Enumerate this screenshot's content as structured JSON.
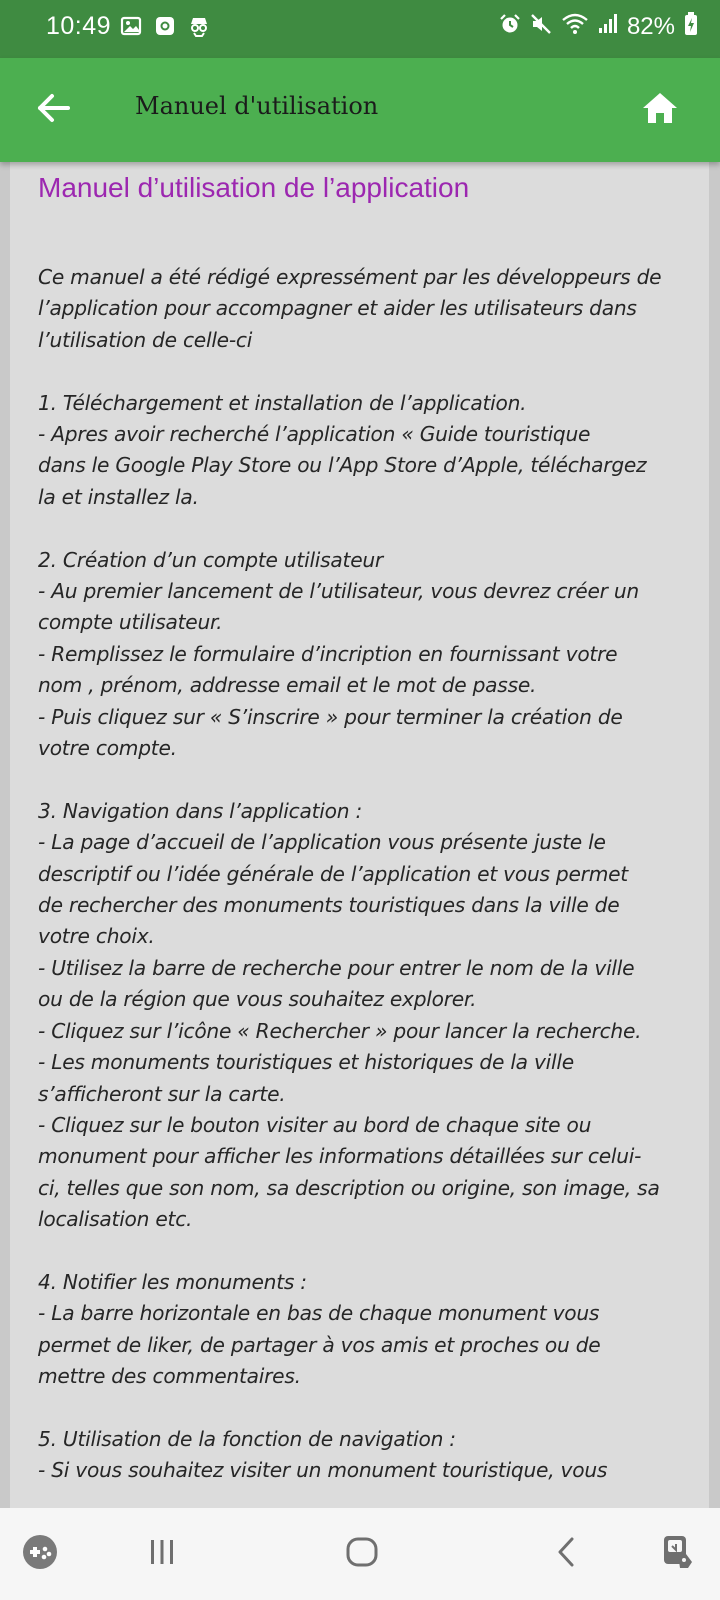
{
  "status_bar": {
    "time": "10:49",
    "battery": "82%",
    "left_icons": [
      "gallery-icon",
      "screen-record-icon",
      "incognito-icon"
    ],
    "right_icons": [
      "alarm-icon",
      "mute-icon",
      "wifi-icon",
      "signal-icon",
      "battery-charging-icon"
    ]
  },
  "app_bar": {
    "title": "Manuel d'utilisation",
    "color": "#4caf50"
  },
  "document": {
    "heading": "Manuel d’utilisation de l’application",
    "heading_color": "#9c27b0",
    "lines": [
      "Ce manuel a été rédigé expressément par les développeurs de",
      "l’application pour accompagner et aider les utilisateurs dans",
      "l’utilisation de celle-ci",
      "",
      "1. Téléchargement et installation de l’application.",
      " - Apres avoir recherché l’application « Guide touristique",
      "dans le Google Play Store ou l’App Store d’Apple, téléchargez",
      "la et installez la.",
      "",
      "2.  Création d’un compte utilisateur",
      "- Au premier lancement de l’utilisateur, vous devrez créer un",
      "compte utilisateur.",
      "- Remplissez le formulaire d’incription en fournissant votre",
      "nom , prénom, addresse email et le mot de passe.",
      "- Puis cliquez sur « S’inscrire » pour terminer la création de",
      "votre compte.",
      "",
      "3. Navigation dans l’application :",
      "- La page d’accueil de l’application vous présente juste le",
      "descriptif ou l’idée générale de l’application et vous permet",
      "de rechercher des monuments touristiques dans la ville de",
      "votre choix.",
      "- Utilisez la barre de recherche pour entrer le nom de la ville",
      "ou de la région que vous souhaitez explorer.",
      "- Cliquez sur l’icône « Rechercher » pour lancer la recherche.",
      "- Les monuments touristiques et historiques de la ville",
      "s’afficheront sur la carte.",
      "- Cliquez sur le bouton visiter au bord de chaque site ou",
      "monument pour afficher les informations détaillées sur celui-",
      "ci, telles que son nom, sa description ou origine, son image, sa",
      "localisation etc.",
      "",
      "4. Notifier les monuments :",
      "- La barre horizontale en bas de chaque monument vous",
      "permet de liker, de partager à vos amis et proches ou de",
      "mettre des commentaires.",
      "",
      "5. Utilisation de la fonction de navigation :",
      "- Si vous souhaitez visiter un monument touristique, vous"
    ]
  },
  "nav_bar": {
    "items": [
      "game-tools-icon",
      "recent-apps-icon",
      "home-icon",
      "back-icon",
      "accessibility-icon"
    ]
  }
}
